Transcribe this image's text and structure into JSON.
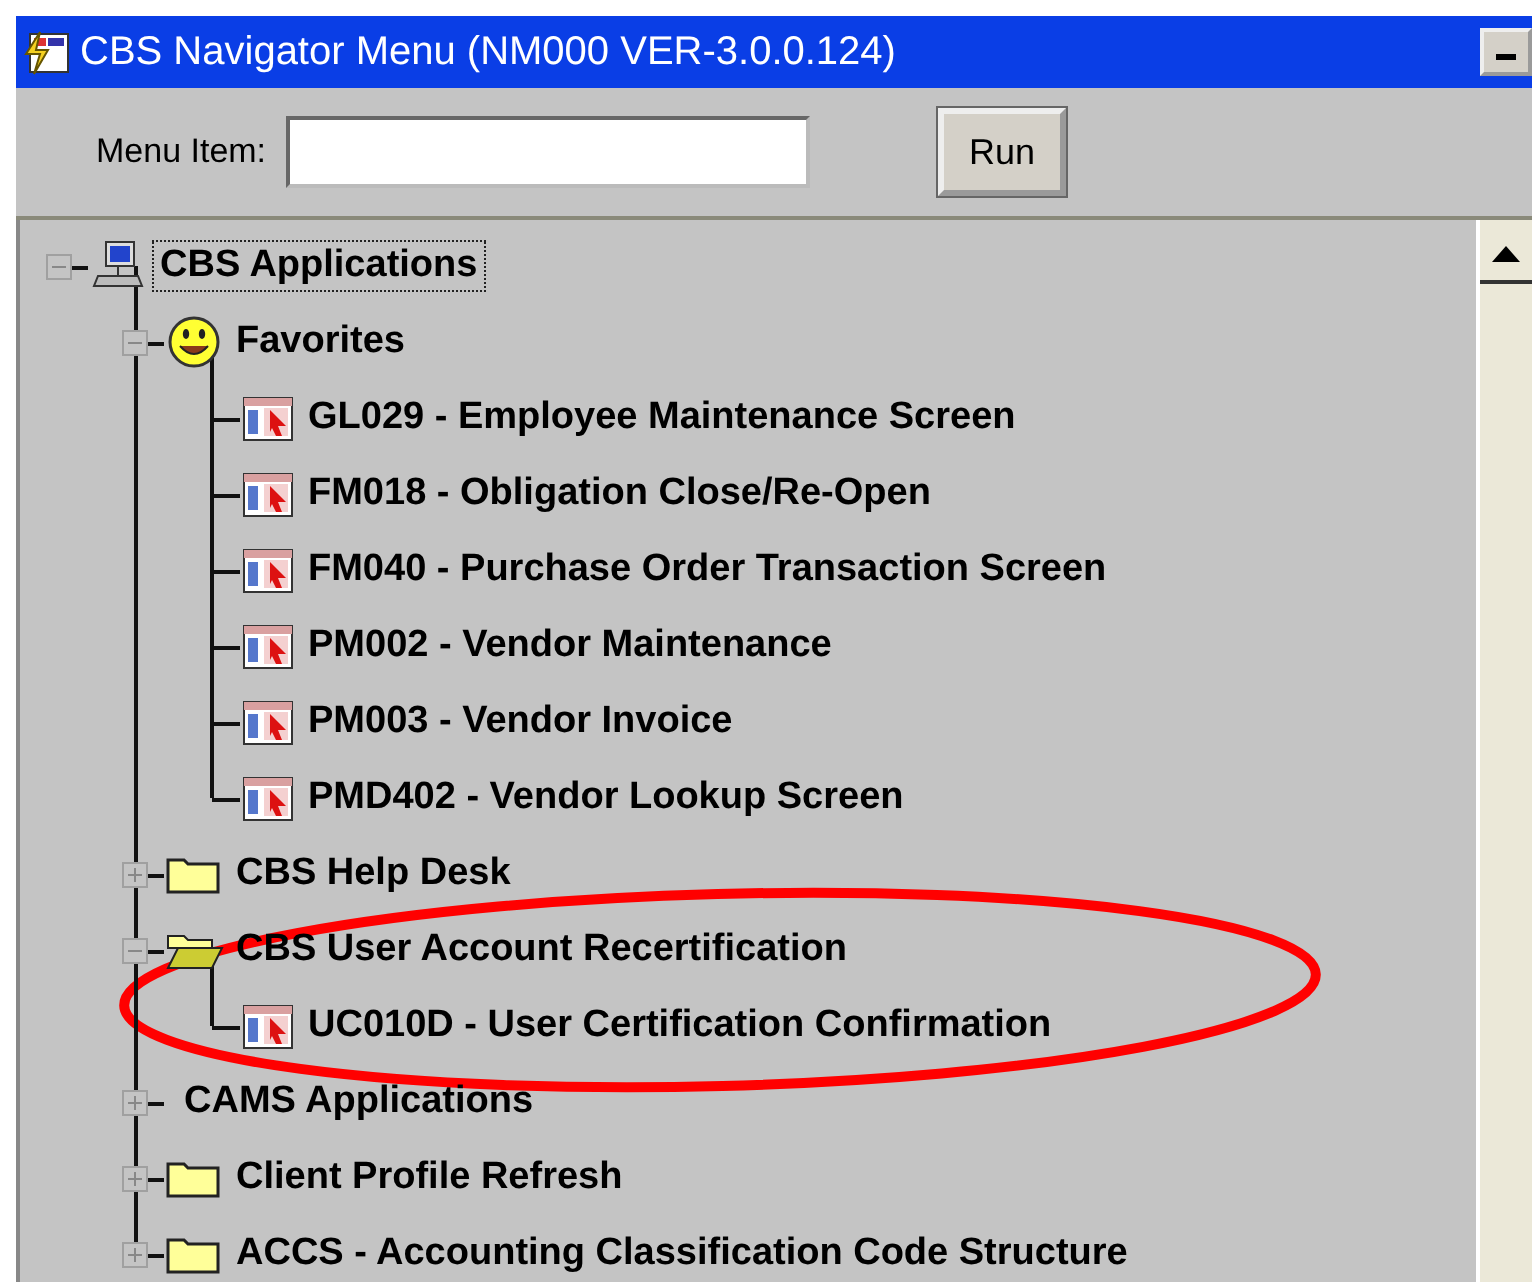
{
  "window": {
    "title": "CBS Navigator Menu (NM000 VER-3.0.0.124)"
  },
  "toolbar": {
    "label": "Menu Item:",
    "button": "Run"
  },
  "tree": [
    {
      "label": "CBS Applications",
      "kind": "computer",
      "expanded": true,
      "selected": true,
      "children": [
        {
          "label": "Favorites",
          "kind": "favorites",
          "expanded": true,
          "selected": false,
          "children": [
            {
              "label": "GL029 - Employee Maintenance Screen",
              "kind": "form",
              "selected": false
            },
            {
              "label": "FM018 - Obligation Close/Re-Open",
              "kind": "form",
              "selected": false
            },
            {
              "label": "FM040 - Purchase Order Transaction Screen",
              "kind": "form",
              "selected": false
            },
            {
              "label": "PM002 - Vendor Maintenance",
              "kind": "form",
              "selected": false
            },
            {
              "label": "PM003 - Vendor Invoice",
              "kind": "form",
              "selected": false
            },
            {
              "label": "PMD402 - Vendor Lookup Screen",
              "kind": "form",
              "selected": false
            }
          ]
        },
        {
          "label": "CBS Help Desk",
          "kind": "folder",
          "expanded": false,
          "selected": false
        },
        {
          "label": "CBS User Account Recertification",
          "kind": "folder",
          "expanded": true,
          "selected": false,
          "children": [
            {
              "label": "UC010D - User Certification Confirmation",
              "kind": "form",
              "selected": false
            }
          ]
        },
        {
          "label": "CAMS Applications",
          "kind": "group",
          "expanded": false,
          "selected": false
        },
        {
          "label": "Client Profile Refresh",
          "kind": "folder",
          "expanded": false,
          "selected": false
        },
        {
          "label": "ACCS - Accounting Classification Code Structure",
          "kind": "folder",
          "expanded": false,
          "selected": false
        }
      ]
    }
  ]
}
